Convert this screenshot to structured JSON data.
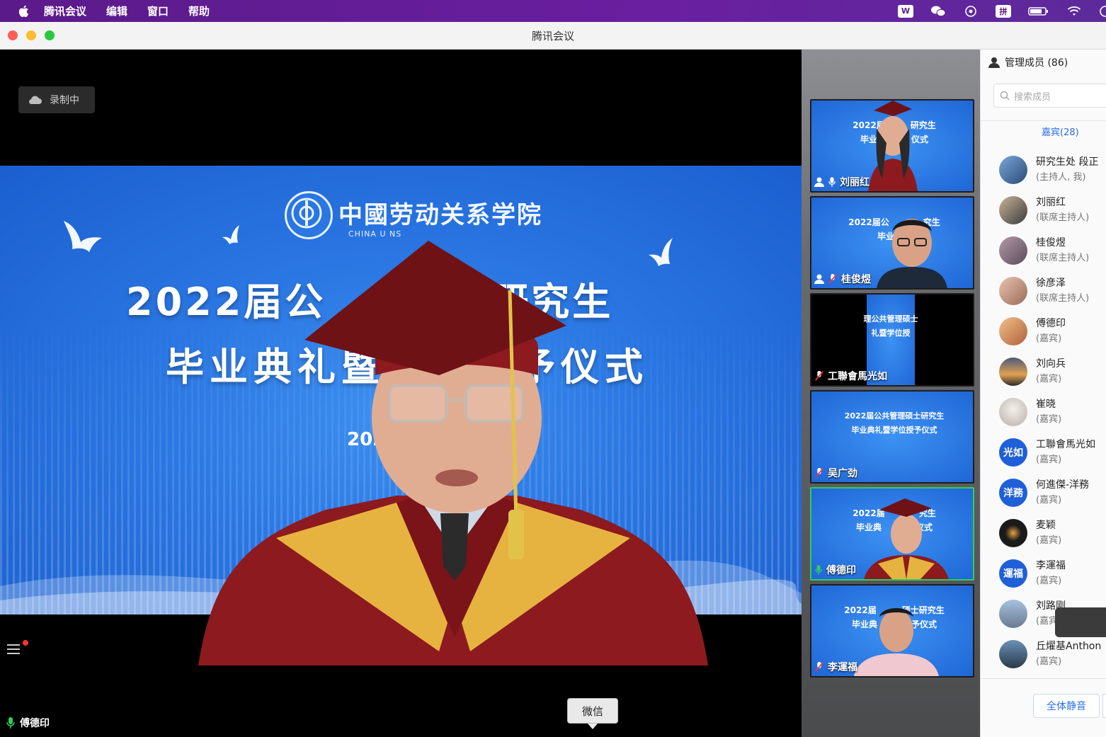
{
  "menubar": {
    "items": [
      "腾讯会议",
      "编辑",
      "窗口",
      "帮助"
    ],
    "tray": {
      "w_icon": "W",
      "ime": "拼"
    }
  },
  "window": {
    "title": "腾讯会议"
  },
  "stage": {
    "recording_label": "录制中",
    "slide": {
      "school_cn": "中國劳动关系学院",
      "school_en": "CHINA U                    NS",
      "line1": "2022届公　　　　研究生",
      "line2": "毕业典礼暨　　　予仪式",
      "date": "2022"
    },
    "speaker": "傅德印",
    "tooltip": "微信"
  },
  "thumbnails": [
    {
      "name": "刘丽红",
      "line1": "2022届　　　研究生",
      "line2": "毕业典　　　仪式"
    },
    {
      "name": "桂俊煜",
      "line1": "2022届公　　　　究生",
      "line2": "毕业典礼"
    },
    {
      "name": "工聯會馬光如",
      "line1": "理公共管理硕士",
      "line2": "礼暨学位授"
    },
    {
      "name": "吴广劲",
      "line1": "2022届公共管理硕士研究生",
      "line2": "毕业典礼暨学位授予仪式"
    },
    {
      "name": "傅德印",
      "line1": "2022届　　　　究生",
      "line2": "毕业典　　　予仪式"
    },
    {
      "name": "李運福",
      "line1": "2022届　　　硕士研究生",
      "line2": "毕业典　　　授予仪式"
    }
  ],
  "panel": {
    "title": "管理成员 (86)",
    "search_placeholder": "搜索成员",
    "guests_tab": "嘉宾(28)",
    "participants": [
      {
        "name": "研究生处 段正",
        "role": "(主持人, 我)",
        "avatar": "photo"
      },
      {
        "name": "刘丽红",
        "role": "(联席主持人)",
        "avatar": "photo"
      },
      {
        "name": "桂俊煜",
        "role": "(联席主持人)",
        "avatar": "photo"
      },
      {
        "name": "徐彦泽",
        "role": "(联席主持人)",
        "avatar": "photo"
      },
      {
        "name": "傅德印",
        "role": "(嘉宾)",
        "avatar": "photo"
      },
      {
        "name": "刘向兵",
        "role": "(嘉宾)",
        "avatar": "photo"
      },
      {
        "name": "崔晓",
        "role": "(嘉宾)",
        "avatar": "photo"
      },
      {
        "name": "工聯會馬光如",
        "role": "(嘉宾)",
        "avatar": "光如"
      },
      {
        "name": "何進傑-洋務",
        "role": "(嘉宾)",
        "avatar": "洋務"
      },
      {
        "name": "麦颖",
        "role": "(嘉宾)",
        "avatar": "photo"
      },
      {
        "name": "李運福",
        "role": "(嘉宾)",
        "avatar": "運福"
      },
      {
        "name": "刘路刚",
        "role": "(嘉宾)",
        "avatar": "photo"
      },
      {
        "name": "丘燿基Anthon",
        "role": "(嘉宾)",
        "avatar": "photo"
      }
    ],
    "mute_all": "全体静音"
  },
  "colors": {
    "menubar": "#5b1a8a",
    "accent": "#2b6ee8",
    "active_border": "#2ccf5a",
    "slide_blue": "#2a76e2"
  }
}
